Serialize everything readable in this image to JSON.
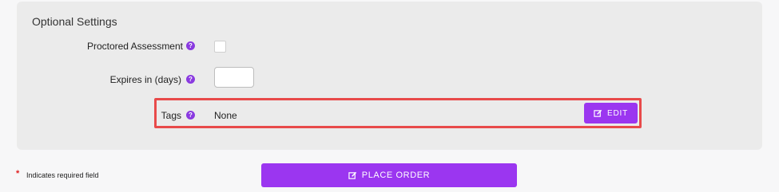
{
  "section": {
    "title": "Optional Settings"
  },
  "fields": {
    "proctored": {
      "label": "Proctored Assessment",
      "checked": false,
      "help_icon": "question-circle-icon"
    },
    "expires": {
      "label": "Expires in (days)",
      "value": "",
      "placeholder": "",
      "help_icon": "question-circle-icon"
    },
    "tags": {
      "label": "Tags",
      "value": "None",
      "help_icon": "question-circle-icon"
    }
  },
  "buttons": {
    "edit": {
      "label": "EDIT",
      "icon": "edit-icon"
    },
    "place_order": {
      "label": "PLACE ORDER",
      "icon": "edit-icon"
    }
  },
  "footer": {
    "required_marker": "*",
    "required_text": "Indicates required field"
  },
  "colors": {
    "accent": "#9b36f0",
    "help_icon": "#8a3ae0",
    "highlight": "#e84a4a",
    "required": "#e02020"
  }
}
